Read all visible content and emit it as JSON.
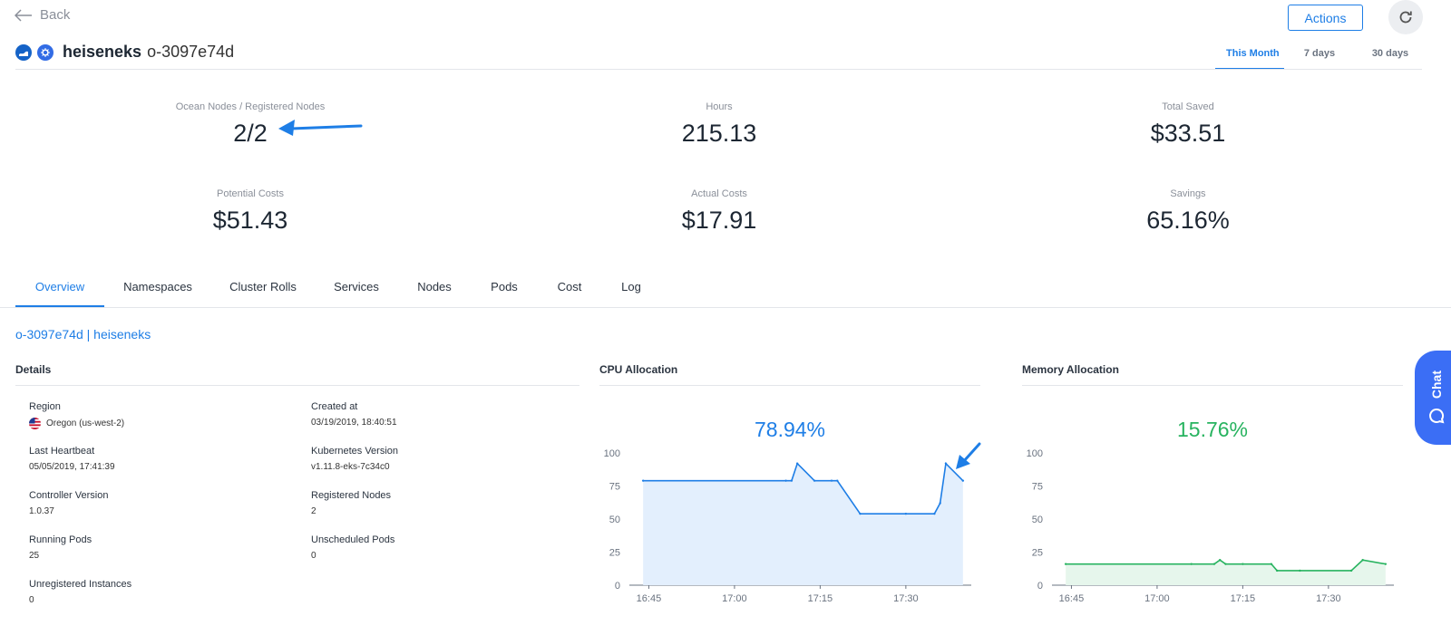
{
  "nav": {
    "back_label": "Back"
  },
  "toolbar": {
    "actions_label": "Actions"
  },
  "cluster": {
    "name": "heiseneks",
    "id": "o-3097e74d"
  },
  "range_tabs": [
    {
      "label": "This Month",
      "active": true
    },
    {
      "label": "7 days",
      "active": false
    },
    {
      "label": "30 days",
      "active": false
    }
  ],
  "stats": [
    {
      "label": "Ocean Nodes / Registered Nodes",
      "value": "2/2"
    },
    {
      "label": "Hours",
      "value": "215.13"
    },
    {
      "label": "Total Saved",
      "value": "$33.51"
    },
    {
      "label": "Potential Costs",
      "value": "$51.43"
    },
    {
      "label": "Actual Costs",
      "value": "$17.91"
    },
    {
      "label": "Savings",
      "value": "65.16%"
    }
  ],
  "tabs": [
    {
      "label": "Overview",
      "active": true
    },
    {
      "label": "Namespaces"
    },
    {
      "label": "Cluster Rolls"
    },
    {
      "label": "Services"
    },
    {
      "label": "Nodes"
    },
    {
      "label": "Pods"
    },
    {
      "label": "Cost"
    },
    {
      "label": "Log"
    }
  ],
  "breadcrumb": "o-3097e74d | heiseneks",
  "details": {
    "title": "Details",
    "items": [
      {
        "label": "Region",
        "value": "Oregon (us-west-2)",
        "icon": "us-flag-icon"
      },
      {
        "label": "Created at",
        "value": "03/19/2019, 18:40:51"
      },
      {
        "label": "Last Heartbeat",
        "value": "05/05/2019, 17:41:39"
      },
      {
        "label": "Kubernetes Version",
        "value": "v1.11.8-eks-7c34c0"
      },
      {
        "label": "Controller Version",
        "value": "1.0.37"
      },
      {
        "label": "Registered Nodes",
        "value": "2"
      },
      {
        "label": "Running Pods",
        "value": "25"
      },
      {
        "label": "Unscheduled Pods",
        "value": "0"
      },
      {
        "label": "Unregistered Instances",
        "value": "0"
      }
    ]
  },
  "cpu": {
    "title": "CPU Allocation",
    "percent": "78.94%",
    "color": "#1e7ee6"
  },
  "memory": {
    "title": "Memory Allocation",
    "percent": "15.76%",
    "color": "#27b35f"
  },
  "chat": {
    "label": "Chat"
  },
  "chart_data": [
    {
      "type": "area",
      "title": "CPU Allocation",
      "x_ticks": [
        "16:45",
        "17:00",
        "17:15",
        "17:30"
      ],
      "y_ticks": [
        0,
        25,
        50,
        75,
        100
      ],
      "ylim": [
        0,
        100
      ],
      "x": [
        "16:44",
        "17:09",
        "17:10",
        "17:11",
        "17:14",
        "17:17",
        "17:18",
        "17:22",
        "17:30",
        "17:35",
        "17:36",
        "17:37",
        "17:40"
      ],
      "values": [
        79,
        79,
        79,
        92,
        79,
        79,
        79,
        54,
        54,
        54,
        62,
        92,
        79
      ],
      "color": "#1e7ee6",
      "fill": "#e3effd"
    },
    {
      "type": "area",
      "title": "Memory Allocation",
      "x_ticks": [
        "16:45",
        "17:00",
        "17:15",
        "17:30"
      ],
      "y_ticks": [
        0,
        25,
        50,
        75,
        100
      ],
      "ylim": [
        0,
        100
      ],
      "x": [
        "16:44",
        "17:06",
        "17:10",
        "17:11",
        "17:12",
        "17:15",
        "17:20",
        "17:21",
        "17:25",
        "17:34",
        "17:36",
        "17:40"
      ],
      "values": [
        16,
        16,
        16,
        19,
        16,
        16,
        16,
        11,
        11,
        11,
        19,
        16
      ],
      "color": "#27b35f",
      "fill": "#e6f6ec"
    }
  ]
}
